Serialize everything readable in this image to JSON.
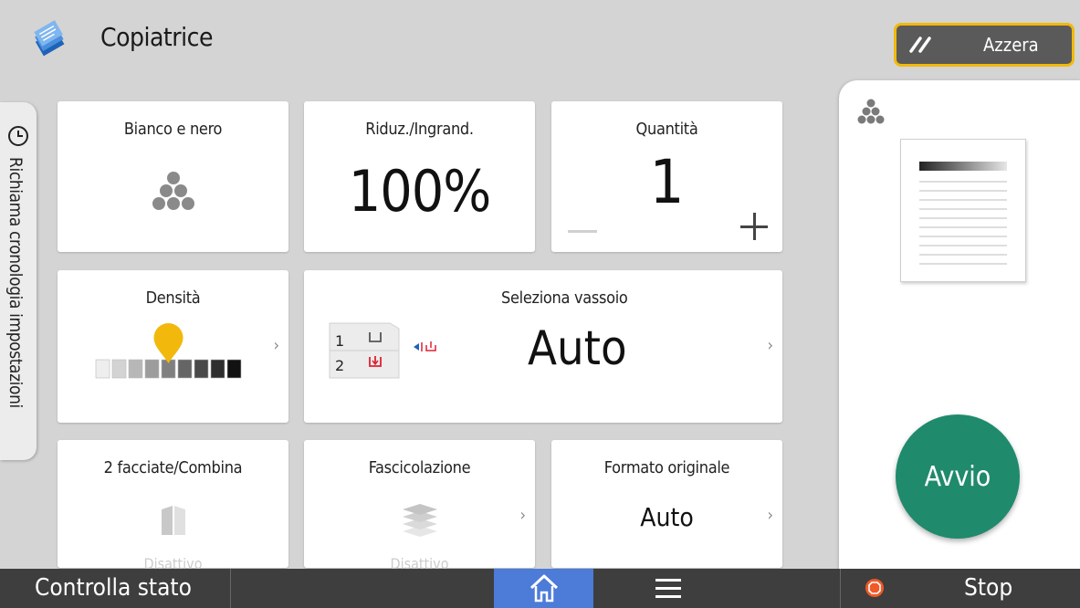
{
  "header": {
    "title": "Copiatrice",
    "reset_label": "Azzera"
  },
  "history_tab": {
    "label": "Richiama cronologia impostazioni"
  },
  "tiles": {
    "color": {
      "title": "Bianco e nero"
    },
    "zoom": {
      "title": "Riduz./Ingrand.",
      "value": "100%"
    },
    "quantity": {
      "title": "Quantità",
      "value": "1"
    },
    "density": {
      "title": "Densità",
      "level": 0.5
    },
    "tray": {
      "title": "Seleziona vassoio",
      "value": "Auto",
      "tray1": "1",
      "tray2": "2"
    },
    "duplex": {
      "title": "2 facciate/Combina",
      "status": "Disattivo"
    },
    "sort": {
      "title": "Fascicolazione",
      "status": "Disattivo"
    },
    "original_size": {
      "title": "Formato originale",
      "value": "Auto"
    }
  },
  "start_button": {
    "label": "Avvio"
  },
  "bottom_bar": {
    "check_status": "Controlla stato",
    "stop_label": "Stop"
  },
  "colors": {
    "start": "#1f8a6c",
    "home": "#4c7bd8",
    "reset_border": "#f2b90c",
    "density_marker": "#f2b90c",
    "stop_icon": "#f05a28"
  }
}
